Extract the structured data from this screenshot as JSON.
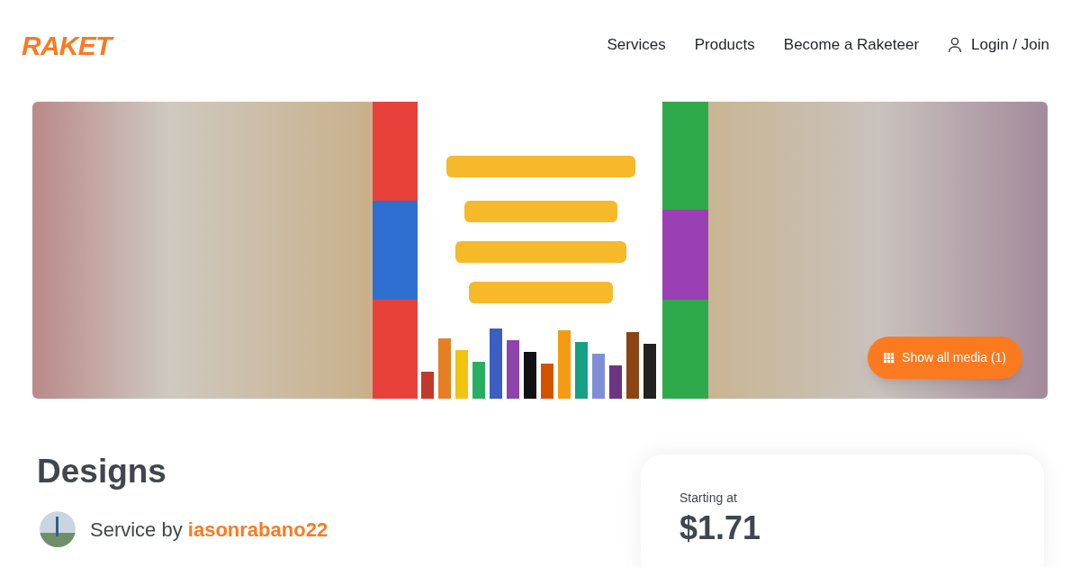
{
  "header": {
    "logo": "RAKET",
    "nav": [
      "Services",
      "Products",
      "Become a Raketeer"
    ],
    "login": "Login / Join"
  },
  "hero": {
    "kind": "picture",
    "media_button": "Show all media (1)"
  },
  "service": {
    "title": "Designs",
    "byline_prefix": "Service by",
    "seller": "iasonrabano22"
  },
  "price_card": {
    "label": "Starting at",
    "price": "$1.71"
  }
}
